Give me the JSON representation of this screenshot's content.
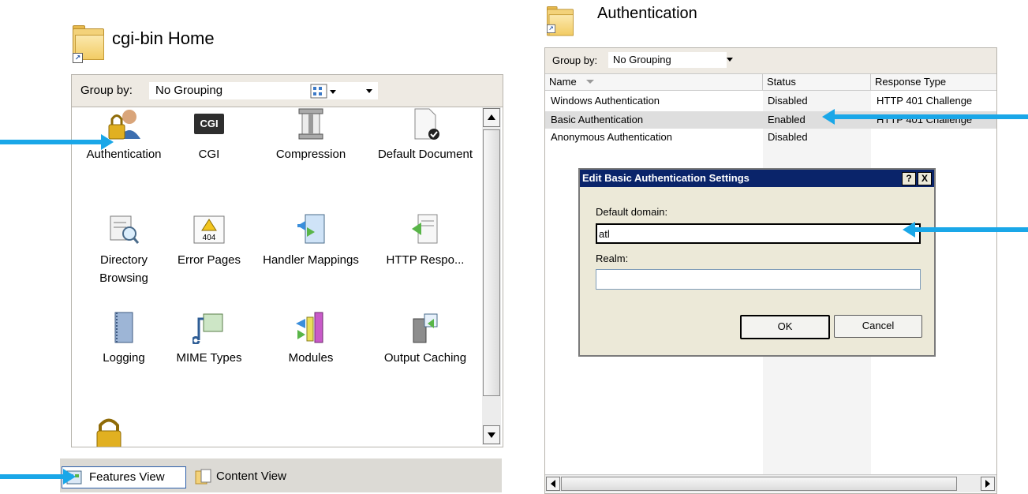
{
  "left": {
    "title": "cgi-bin Home",
    "group_by_label": "Group by:",
    "group_by_value": "No Grouping",
    "features": [
      {
        "label": "Authentication",
        "icon": "authentication-icon"
      },
      {
        "label": "CGI",
        "icon": "cgi-icon"
      },
      {
        "label": "Compression",
        "icon": "compression-icon"
      },
      {
        "label": "Default Document",
        "icon": "default-document-icon"
      },
      {
        "label": "Directory Browsing",
        "icon": "directory-browsing-icon"
      },
      {
        "label": "Error Pages",
        "icon": "error-pages-icon"
      },
      {
        "label": "Handler Mappings",
        "icon": "handler-mappings-icon"
      },
      {
        "label": "HTTP Respo...",
        "icon": "http-response-icon"
      },
      {
        "label": "Logging",
        "icon": "logging-icon"
      },
      {
        "label": "MIME Types",
        "icon": "mime-types-icon"
      },
      {
        "label": "Modules",
        "icon": "modules-icon"
      },
      {
        "label": "Output Caching",
        "icon": "output-caching-icon"
      }
    ],
    "cgi_icon_text": "CGI",
    "error_icon_text": "404",
    "features_view_label": "Features View",
    "content_view_label": "Content View"
  },
  "right": {
    "title": "Authentication",
    "group_by_label": "Group by:",
    "group_by_value": "No Grouping",
    "columns": [
      "Name",
      "Status",
      "Response Type"
    ],
    "rows": [
      {
        "name": "Windows Authentication",
        "status": "Disabled",
        "response": "HTTP 401 Challenge"
      },
      {
        "name": "Basic Authentication",
        "status": "Enabled",
        "response": "HTTP 401 Challenge"
      },
      {
        "name": "Anonymous Authentication",
        "status": "Disabled",
        "response": ""
      }
    ],
    "dialog": {
      "title": "Edit Basic Authentication Settings",
      "help_label": "?",
      "close_label": "X",
      "default_domain_label": "Default domain:",
      "default_domain_value": "atl",
      "realm_label": "Realm:",
      "realm_value": "",
      "ok_label": "OK",
      "cancel_label": "Cancel"
    }
  },
  "colors": {
    "arrow": "#1aa7e8",
    "dialog_titlebar": "#0a246a",
    "panel_bar": "#eeeae3"
  }
}
